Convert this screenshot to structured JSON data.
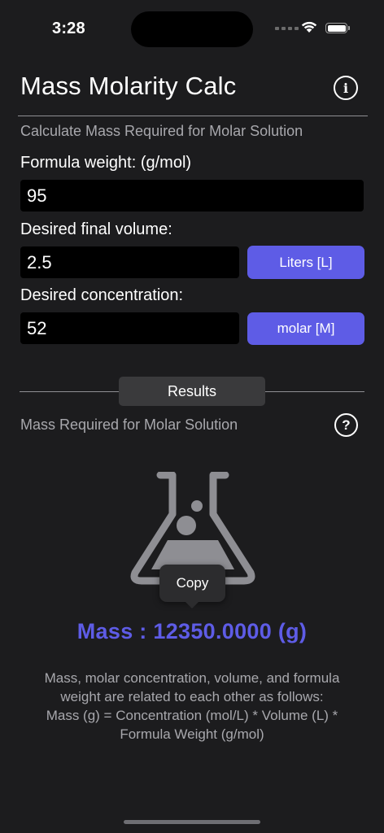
{
  "status_bar": {
    "time": "3:28"
  },
  "header": {
    "title": "Mass Molarity Calc",
    "info_icon": "info-circle-icon"
  },
  "form": {
    "subtitle": "Calculate Mass Required for Molar Solution",
    "formula_weight": {
      "label": "Formula weight:  (g/mol)",
      "value": "95"
    },
    "volume": {
      "label": "Desired final volume:",
      "value": "2.5",
      "unit_button": "Liters [L]"
    },
    "concentration": {
      "label": "Desired concentration:",
      "value": "52",
      "unit_button": "molar [M]"
    }
  },
  "results": {
    "tab_label": "Results",
    "subtitle": "Mass Required for Molar Solution",
    "help_icon": "question-circle-icon",
    "flask_icon": "flask-icon",
    "copy_label": "Copy",
    "mass_text": "Mass : 12350.0000 (g)",
    "explanation": [
      "Mass, molar concentration, volume, and formula",
      "weight are related to each other as follows:",
      "Mass (g) = Concentration (mol/L) * Volume (L) *",
      "Formula Weight (g/mol)"
    ]
  },
  "colors": {
    "background": "#1c1c1e",
    "accent": "#5e5ce6",
    "input_bg": "#000000",
    "secondary_text": "#a8a8ad"
  }
}
